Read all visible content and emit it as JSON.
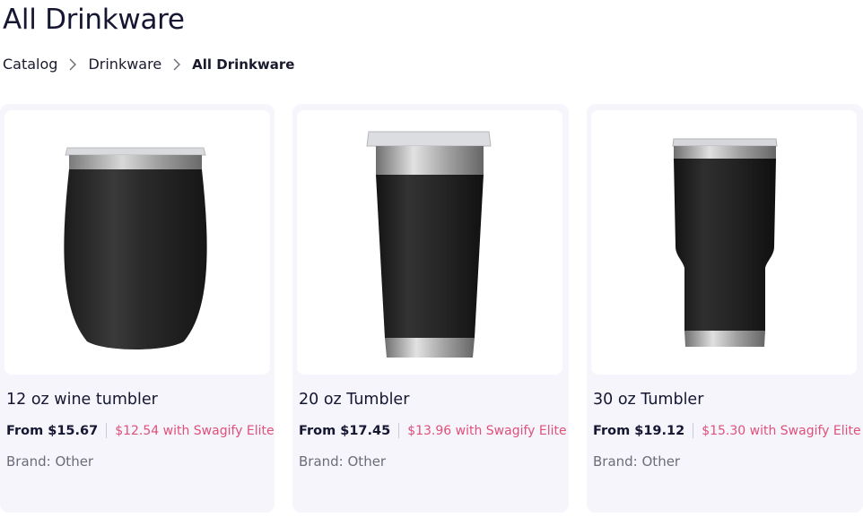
{
  "page": {
    "title": "All Drinkware"
  },
  "breadcrumb": {
    "items": [
      {
        "label": "Catalog"
      },
      {
        "label": "Drinkware"
      },
      {
        "label": "All Drinkware"
      }
    ]
  },
  "colors": {
    "accent": "#e0507a",
    "card_bg": "#f5f5fb",
    "text": "#151632"
  },
  "products": [
    {
      "name": "12 oz wine tumbler",
      "price": "From $15.67",
      "elite_price": "$12.54 with Swagify Elite",
      "brand": "Brand: Other",
      "image": "wine-tumbler-image"
    },
    {
      "name": "20 oz Tumbler",
      "price": "From $17.45",
      "elite_price": "$13.96 with Swagify Elite",
      "brand": "Brand: Other",
      "image": "tumbler-20oz-image"
    },
    {
      "name": "30 oz Tumbler",
      "price": "From $19.12",
      "elite_price": "$15.30 with Swagify Elite",
      "brand": "Brand: Other",
      "image": "tumbler-30oz-image"
    }
  ]
}
